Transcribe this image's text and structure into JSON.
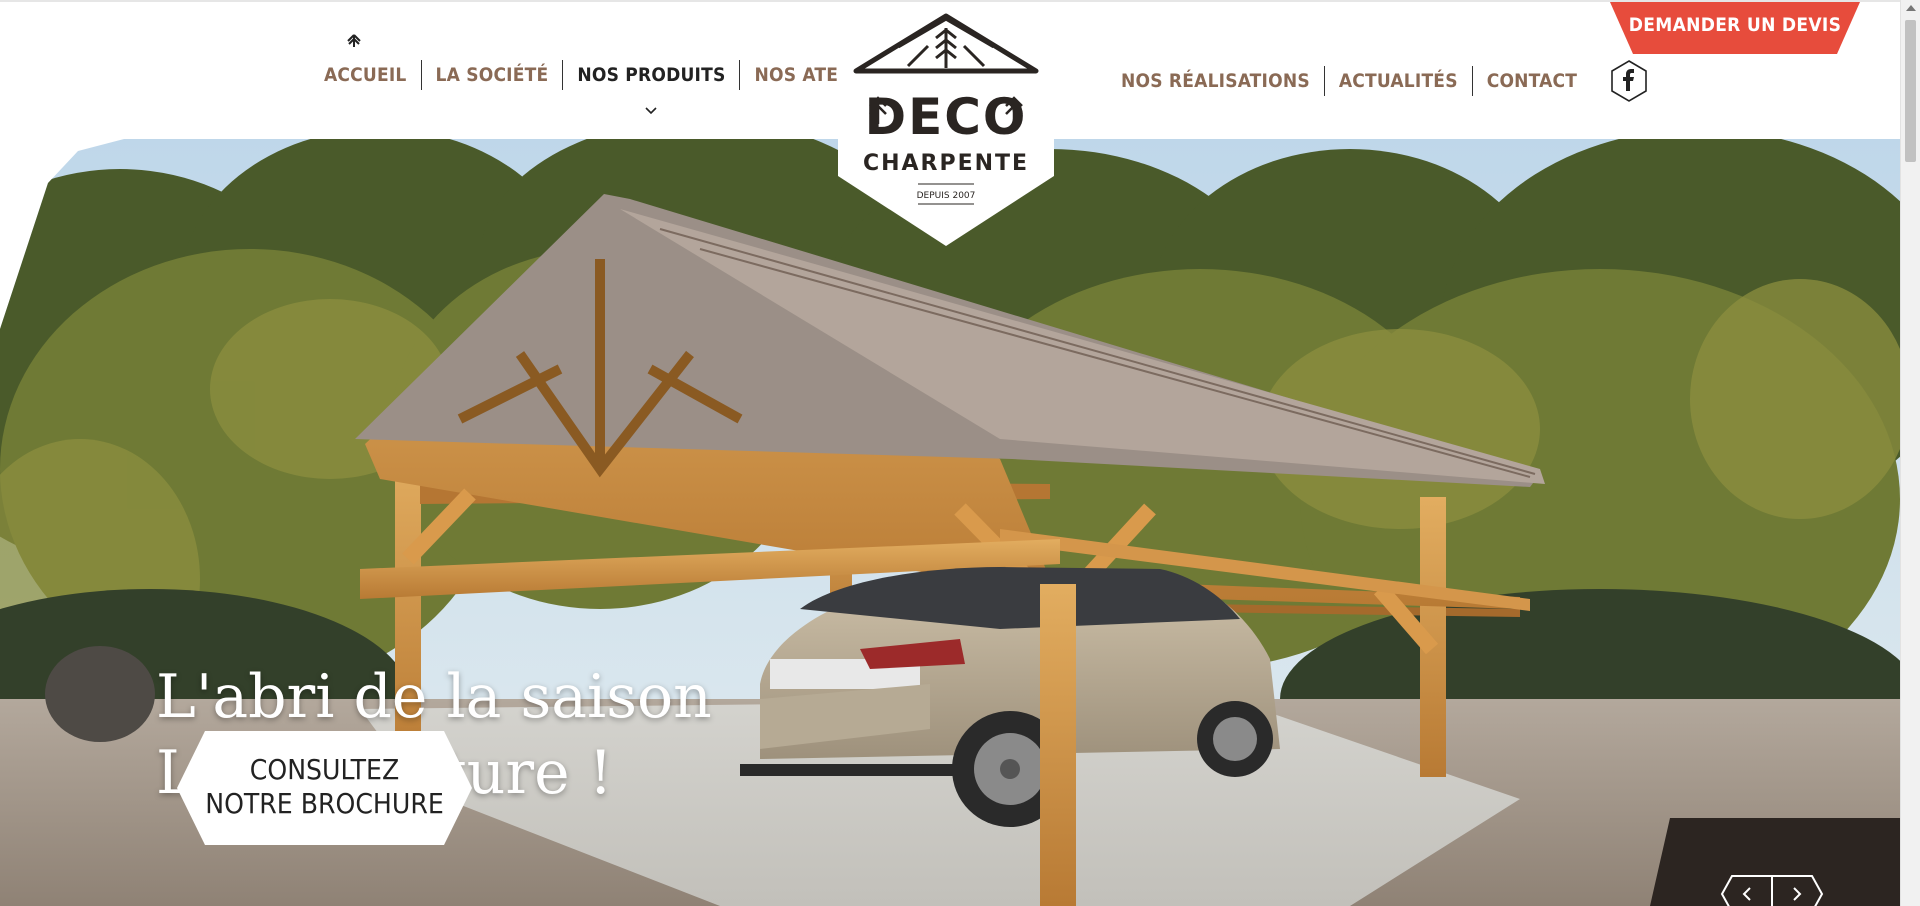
{
  "nav": {
    "left": [
      "ACCUEIL",
      "LA SOCIÉTÉ",
      "NOS PRODUITS",
      "NOS ATELIERS"
    ],
    "right": [
      "NOS RÉALISATIONS",
      "ACTUALITÉS",
      "CONTACT"
    ],
    "active": "NOS PRODUITS",
    "home_icon": "tree-icon",
    "dropdown_icon": "chevron-down-icon",
    "social_icon": "facebook-icon"
  },
  "cta_devis": "DEMANDER UN DEVIS",
  "logo": {
    "line1": "DECO",
    "line2": "CHARPENTE",
    "tagline": "DEPUIS 2007"
  },
  "hero": {
    "headline_1": "L'abri de la saison",
    "headline_2": "L'abri voiture !",
    "cta_line1": "CONSULTEZ",
    "cta_line2": "NOTRE BROCHURE",
    "prev_icon": "arrow-left-icon",
    "next_icon": "arrow-right-icon"
  },
  "colors": {
    "accent_red": "#e74c3c",
    "nav_brown": "#8a6a55",
    "dark": "#2a2522",
    "wood": "#c98a3a"
  }
}
